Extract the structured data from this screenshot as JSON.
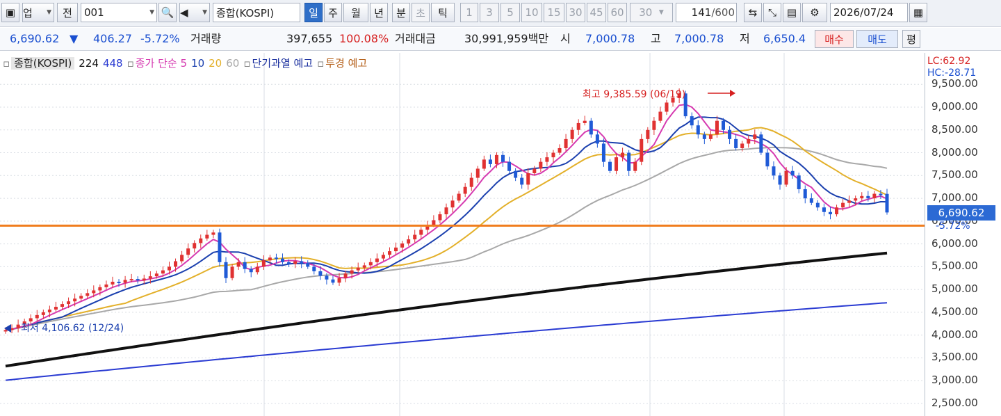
{
  "toolbar": {
    "market": "업",
    "prev": "전",
    "code": "001",
    "name": "종합(KOSPI)",
    "periods": [
      "일",
      "주",
      "월",
      "년",
      "분",
      "초",
      "틱"
    ],
    "intervals": [
      "1",
      "3",
      "5",
      "10",
      "15",
      "30",
      "45",
      "60"
    ],
    "count_value": "30",
    "bar_count": "141",
    "bar_total": "/600",
    "date": "2026/07/24"
  },
  "quote": {
    "price": "6,690.62",
    "change_arrow": "▼",
    "change": "406.27",
    "change_pct": "-5.72%",
    "volume_label": "거래량",
    "volume": "397,655",
    "volume_ratio": "100.08%",
    "amount_label": "거래대금",
    "amount": "30,991,959백만",
    "open_label": "시",
    "open": "7,000.78",
    "high_label": "고",
    "high": "7,000.78",
    "low_label": "저",
    "low": "6,650.4",
    "buy": "매수",
    "sell": "매도",
    "eval": "평"
  },
  "legend": {
    "symbol": "종합(KOSPI)",
    "n1": "224",
    "n2": "448",
    "ma_label": "종가 단순 5",
    "ma10": "10",
    "ma20": "20",
    "ma60": "60",
    "overheat": "단기과열 예고",
    "warning": "투경 예고"
  },
  "annotations": {
    "high": "최고 9,385.59 (06/19)",
    "low": "최저 4,106.62 (12/24)",
    "lc": "LC:62.92",
    "hc": "HC:-28.71",
    "current": "6,690.62",
    "current_pct": "-5.72%"
  },
  "colors": {
    "up": "#e03131",
    "down": "#1f5ad6",
    "ma5": "#d63ab0",
    "ma10": "#1a3fae",
    "ma20": "#e3b02a",
    "ma60": "#a8a8a8",
    "ma224": "#111111",
    "ma448": "#2a3bd2",
    "hline": "#f07d1e"
  },
  "chart_data": {
    "type": "candlestick",
    "y_ticks": [
      "9,500.00",
      "9,000.00",
      "8,500.00",
      "8,000.00",
      "7,500.00",
      "7,000.00",
      "6,500.00",
      "6,000.00",
      "5,500.00",
      "5,000.00",
      "4,500.00",
      "4,000.00",
      "3,500.00",
      "3,000.00",
      "2,500.00"
    ],
    "ylim": [
      2300,
      9650
    ],
    "horizontal_line": 6400,
    "close": [
      4110,
      4150,
      4230,
      4300,
      4370,
      4440,
      4500,
      4560,
      4620,
      4680,
      4740,
      4800,
      4860,
      4920,
      4980,
      5050,
      5110,
      5170,
      5150,
      5210,
      5230,
      5200,
      5240,
      5290,
      5350,
      5420,
      5500,
      5620,
      5760,
      5900,
      6020,
      6120,
      6200,
      6250,
      5600,
      5250,
      5500,
      5600,
      5450,
      5380,
      5500,
      5640,
      5700,
      5680,
      5600,
      5560,
      5620,
      5580,
      5500,
      5400,
      5300,
      5220,
      5150,
      5250,
      5350,
      5420,
      5480,
      5530,
      5600,
      5680,
      5760,
      5840,
      5920,
      6010,
      6100,
      6200,
      6310,
      6420,
      6520,
      6650,
      6800,
      6950,
      7100,
      7250,
      7450,
      7650,
      7850,
      7750,
      7950,
      7800,
      7600,
      7450,
      7300,
      7550,
      7650,
      7800,
      7900,
      8000,
      8100,
      8300,
      8500,
      8650,
      8700,
      8400,
      8200,
      7800,
      7600,
      7900,
      8000,
      7600,
      7800,
      8300,
      8500,
      8700,
      8900,
      9100,
      9200,
      9300,
      8800,
      8600,
      8400,
      8300,
      8400,
      8700,
      8500,
      8300,
      8100,
      8200,
      8300,
      8400,
      8000,
      7700,
      7500,
      7300,
      7600,
      7500,
      7200,
      7000,
      6900,
      6800,
      6700,
      6650,
      6800,
      6900,
      6950,
      7000,
      7050,
      7000,
      7100,
      7097,
      6690
    ],
    "ma224": [
      3320,
      5800
    ],
    "ma448": [
      3010,
      4710
    ],
    "ma60_note": "gray",
    "x_dividers": [
      380,
      575,
      935,
      1128
    ]
  }
}
